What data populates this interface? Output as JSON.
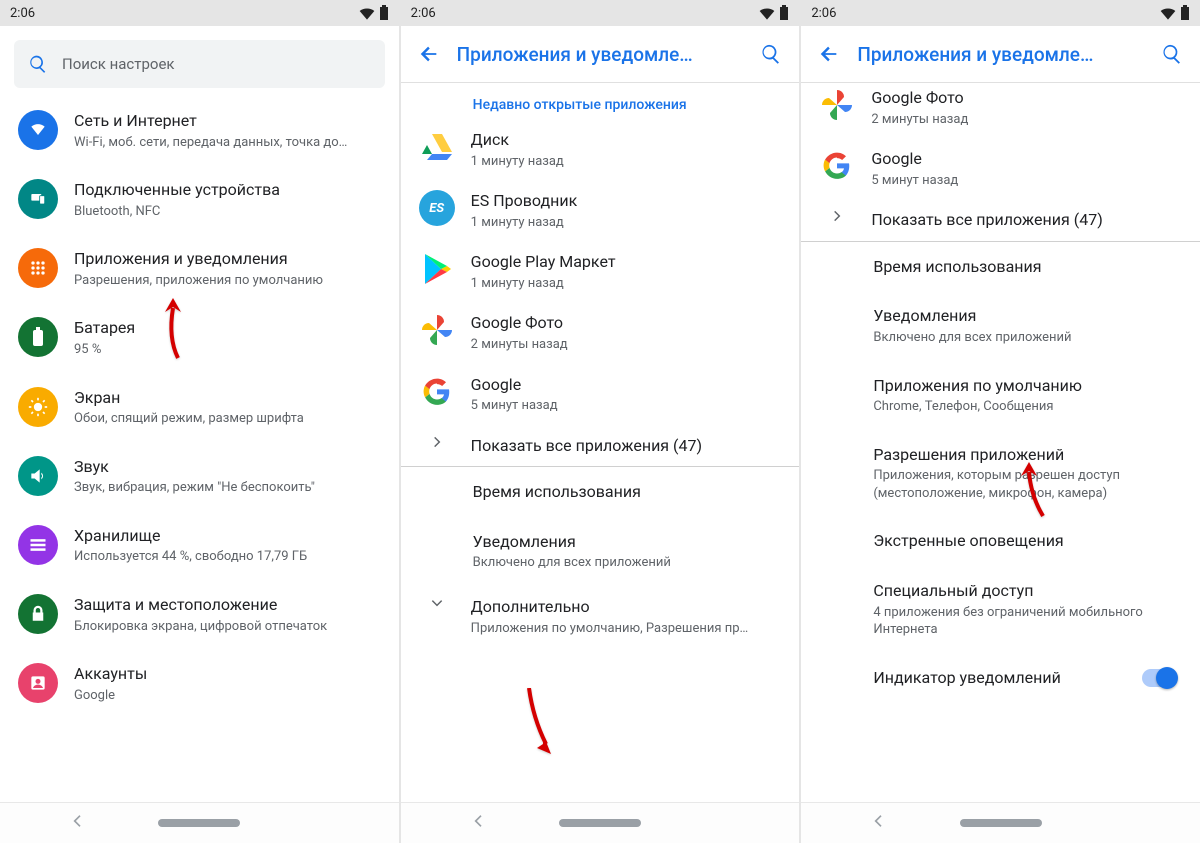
{
  "status": {
    "time": "2:06"
  },
  "p1": {
    "search_placeholder": "Поиск настроек",
    "items": [
      {
        "title": "Сеть и Интернет",
        "sub": "Wi-Fi, моб. сети, передача данных, точка до…"
      },
      {
        "title": "Подключенные устройства",
        "sub": "Bluetooth, NFC"
      },
      {
        "title": "Приложения и уведомления",
        "sub": "Разрешения, приложения по умолчанию"
      },
      {
        "title": "Батарея",
        "sub": "95 %"
      },
      {
        "title": "Экран",
        "sub": "Обои, спящий режим, размер шрифта"
      },
      {
        "title": "Звук",
        "sub": "Звук, вибрация, режим \"Не беспокоить\""
      },
      {
        "title": "Хранилище",
        "sub": "Используется 44 %, свободно 17,79 ГБ"
      },
      {
        "title": "Защита и местоположение",
        "sub": "Блокировка экрана, цифровой отпечаток"
      },
      {
        "title": "Аккаунты",
        "sub": "Google"
      }
    ]
  },
  "p2": {
    "header": "Приложения и уведомле…",
    "recent_header": "Недавно открытые приложения",
    "apps": [
      {
        "title": "Диск",
        "sub": "1 минуту назад"
      },
      {
        "title": "ES Проводник",
        "sub": "1 минуту назад"
      },
      {
        "title": "Google Play Маркет",
        "sub": "1 минуту назад"
      },
      {
        "title": "Google Фото",
        "sub": "2 минуты назад"
      },
      {
        "title": "Google",
        "sub": "5 минут назад"
      }
    ],
    "show_all": "Показать все приложения (47)",
    "sections": {
      "screen_time": "Время использования",
      "notifications_title": "Уведомления",
      "notifications_sub": "Включено для всех приложений",
      "advanced_title": "Дополнительно",
      "advanced_sub": "Приложения по умолчанию, Разрешения пр…"
    }
  },
  "p3": {
    "header": "Приложения и уведомле…",
    "apps": [
      {
        "title": "Google Фото",
        "sub": "2 минуты назад"
      },
      {
        "title": "Google",
        "sub": "5 минут назад"
      }
    ],
    "show_all": "Показать все приложения (47)",
    "sections": {
      "screen_time": "Время использования",
      "notifications_title": "Уведомления",
      "notifications_sub": "Включено для всех приложений",
      "default_title": "Приложения по умолчанию",
      "default_sub": "Chrome, Телефон, Сообщения",
      "perm_title": "Разрешения приложений",
      "perm_sub": "Приложения, которым разрешен доступ (местоположение, микрофон, камера)",
      "emergency": "Экстренные оповещения",
      "special_title": "Специальный доступ",
      "special_sub": "4 приложения без ограничений мобильного Интернета",
      "indicator": "Индикатор уведомлений"
    }
  }
}
